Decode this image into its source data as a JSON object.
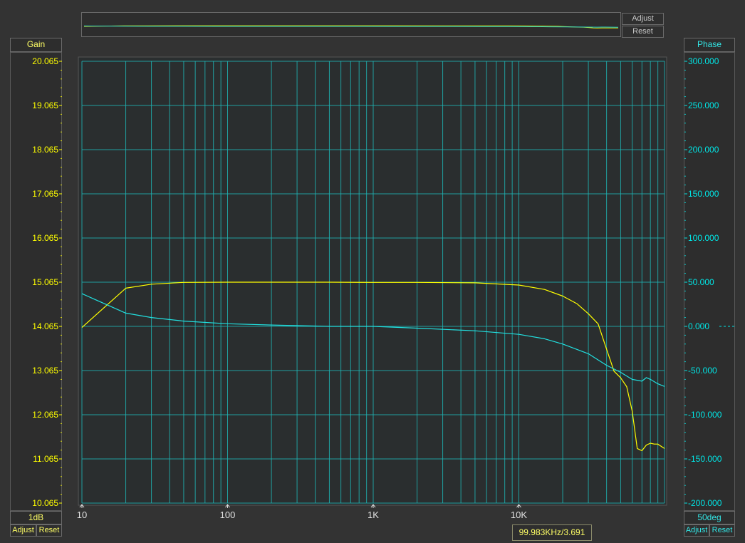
{
  "overview": {
    "adjust_label": "Adjust",
    "reset_label": "Reset"
  },
  "left_axis": {
    "title": "Gain",
    "scale_label": "1dB",
    "adjust_label": "Adjust",
    "reset_label": "Reset",
    "color": "#ffff00"
  },
  "right_axis": {
    "title": "Phase",
    "scale_label": "50deg",
    "adjust_label": "Adjust",
    "reset_label": "Reset",
    "color": "#00e5e5"
  },
  "cursor_readout": "99.983KHz/3.691",
  "colors": {
    "background": "#333333",
    "plot_background": "#2a2e2f",
    "grid": "#1fb3b3",
    "gain_trace": "#ffff00",
    "phase_trace": "#22e0e0"
  },
  "chart_data": {
    "type": "line",
    "x_scale": "log",
    "xlim": [
      10,
      100000
    ],
    "x_tick_values": [
      10,
      100,
      1000,
      10000
    ],
    "x_tick_labels": [
      "10",
      "100",
      "1K",
      "10K"
    ],
    "y_left": {
      "label": "Gain",
      "ylim": [
        10.065,
        20.065
      ],
      "tick_labels": [
        "20.065",
        "19.065",
        "18.065",
        "17.065",
        "16.065",
        "15.065",
        "14.065",
        "13.065",
        "12.065",
        "11.065",
        "10.065"
      ]
    },
    "y_right": {
      "label": "Phase",
      "ylim": [
        -200,
        300
      ],
      "tick_labels": [
        "300.000",
        "250.000",
        "200.000",
        "150.000",
        "100.000",
        "50.000",
        "0.000",
        "-50.000",
        "-100.000",
        "-150.000",
        "-200.000"
      ]
    },
    "grid": true,
    "series": [
      {
        "name": "Gain",
        "axis": "left",
        "x": [
          10,
          20,
          30,
          50,
          100,
          200,
          500,
          1000,
          2000,
          5000,
          10000,
          15000,
          20000,
          25000,
          30000,
          35000,
          40000,
          45000,
          50000,
          55000,
          60000,
          65000,
          70000,
          75000,
          80000,
          85000,
          90000,
          100000
        ],
        "y": [
          14.04,
          14.93,
          15.02,
          15.06,
          15.065,
          15.065,
          15.065,
          15.06,
          15.06,
          15.05,
          15.0,
          14.9,
          14.75,
          14.58,
          14.35,
          14.12,
          13.55,
          13.05,
          12.9,
          12.7,
          12.15,
          11.3,
          11.25,
          11.38,
          11.42,
          11.4,
          11.4,
          11.3
        ]
      },
      {
        "name": "Phase",
        "axis": "right",
        "x": [
          10,
          20,
          30,
          50,
          100,
          200,
          500,
          1000,
          2000,
          5000,
          10000,
          15000,
          20000,
          30000,
          40000,
          50000,
          60000,
          70000,
          75000,
          80000,
          90000,
          100000
        ],
        "y": [
          37,
          15,
          10,
          6,
          3,
          1.5,
          0,
          0,
          -2,
          -5,
          -9,
          -14,
          -20,
          -31,
          -44,
          -52,
          -60,
          -62,
          -58,
          -60,
          -65,
          -68
        ]
      }
    ]
  }
}
